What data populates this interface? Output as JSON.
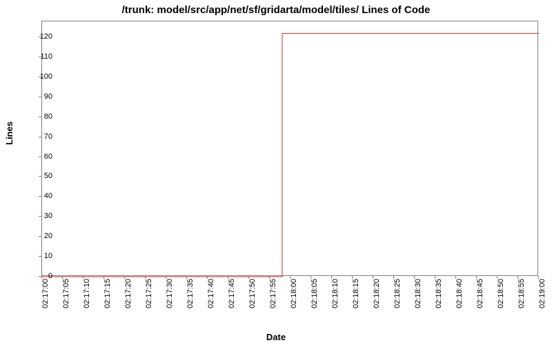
{
  "chart_data": {
    "type": "line",
    "title": "/trunk: model/src/app/net/sf/gridarta/model/tiles/ Lines of Code",
    "xlabel": "Date",
    "ylabel": "Lines",
    "ylim": [
      0,
      128
    ],
    "xlim": [
      "02:17:00",
      "02:19:00"
    ],
    "y_ticks": [
      0,
      10,
      20,
      30,
      40,
      50,
      60,
      70,
      80,
      90,
      100,
      110,
      120
    ],
    "x_ticks": [
      "02:17:00",
      "02:17:05",
      "02:17:10",
      "02:17:15",
      "02:17:20",
      "02:17:25",
      "02:17:30",
      "02:17:35",
      "02:17:40",
      "02:17:45",
      "02:17:50",
      "02:17:55",
      "02:18:00",
      "02:18:05",
      "02:18:10",
      "02:18:15",
      "02:18:20",
      "02:18:25",
      "02:18:30",
      "02:18:35",
      "02:18:40",
      "02:18:45",
      "02:18:50",
      "02:18:55",
      "02:19:00"
    ],
    "series": [
      {
        "name": "Lines of Code",
        "color": "#d62728",
        "points": [
          {
            "x": "02:17:00",
            "y": 0
          },
          {
            "x": "02:17:58",
            "y": 0
          },
          {
            "x": "02:17:58",
            "y": 122
          },
          {
            "x": "02:19:00",
            "y": 122
          }
        ]
      }
    ]
  }
}
